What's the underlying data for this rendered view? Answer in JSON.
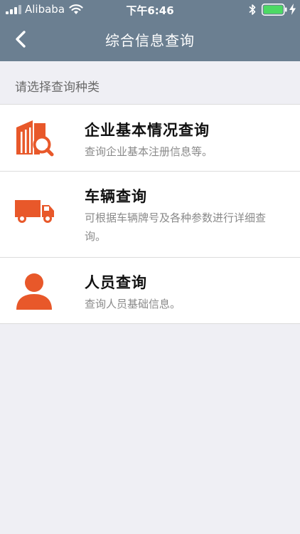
{
  "status_bar": {
    "carrier": "Alibaba",
    "time": "下午6:46",
    "icons": [
      "signal-icon",
      "wifi-icon",
      "bluetooth-icon",
      "battery-icon",
      "charging-icon"
    ]
  },
  "nav": {
    "title": "综合信息查询",
    "back_icon": "chevron-left-icon"
  },
  "section": {
    "label": "请选择查询种类"
  },
  "items": [
    {
      "title": "企业基本情况查询",
      "description": "查询企业基本注册信息等。",
      "icon": "building-search-icon"
    },
    {
      "title": "车辆查询",
      "description": "可根据车辆牌号及各种参数进行详细查询。",
      "icon": "truck-icon"
    },
    {
      "title": "人员查询",
      "description": "查询人员基础信息。",
      "icon": "person-icon"
    }
  ],
  "colors": {
    "header_bg": "#6b7f91",
    "accent_orange": "#e8582a",
    "page_bg": "#efeff4"
  }
}
